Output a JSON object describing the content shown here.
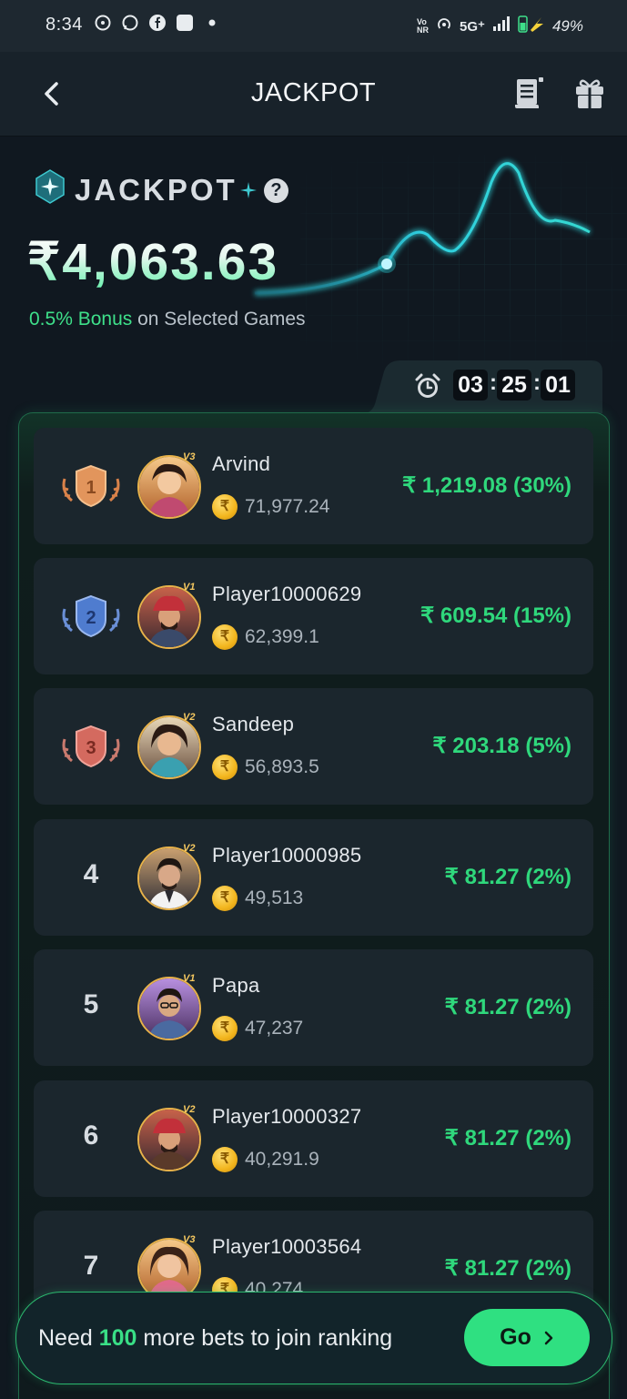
{
  "status_bar": {
    "time": "8:34",
    "network": "5G⁺",
    "battery": "49%"
  },
  "header": {
    "title": "JACKPOT"
  },
  "hero": {
    "label": "JACKPOT",
    "amount": "₹4,063.63",
    "bonus_highlight": "0.5% Bonus",
    "bonus_rest": " on Selected Games"
  },
  "timer": {
    "hours": "03",
    "minutes": "25",
    "seconds": "01",
    "separator": ":"
  },
  "ranking": [
    {
      "rank": "1",
      "name": "Arvind",
      "vip": "V3",
      "score": "71,977.24",
      "prize": "₹ 1,219.08 (30%)"
    },
    {
      "rank": "2",
      "name": "Player10000629",
      "vip": "V1",
      "score": "62,399.1",
      "prize": "₹ 609.54 (15%)"
    },
    {
      "rank": "3",
      "name": "Sandeep",
      "vip": "V2",
      "score": "56,893.5",
      "prize": "₹ 203.18 (5%)"
    },
    {
      "rank": "4",
      "name": "Player10000985",
      "vip": "V2",
      "score": "49,513",
      "prize": "₹ 81.27 (2%)"
    },
    {
      "rank": "5",
      "name": "Papa",
      "vip": "V1",
      "score": "47,237",
      "prize": "₹ 81.27 (2%)"
    },
    {
      "rank": "6",
      "name": "Player10000327",
      "vip": "V2",
      "score": "40,291.9",
      "prize": "₹ 81.27 (2%)"
    },
    {
      "rank": "7",
      "name": "Player10003564",
      "vip": "V3",
      "score": "40,274",
      "prize": "₹ 81.27 (2%)"
    }
  ],
  "cta": {
    "prefix": "Need ",
    "count": "100",
    "suffix": " more bets to join ranking",
    "button": "Go"
  },
  "colors": {
    "accent_green": "#2fd87c",
    "background": "#101820",
    "card": "#1b262d",
    "gold": "#f2b51d",
    "bronze_medal": "#d9824a",
    "silver_medal": "#4f7ccf",
    "third_medal": "#d46a5f"
  },
  "icons": [
    "back-arrow-icon",
    "receipt-icon",
    "gift-icon",
    "jackpot-gem-icon",
    "help-icon",
    "alarm-clock-icon",
    "coin-icon",
    "chevron-right-icon"
  ]
}
